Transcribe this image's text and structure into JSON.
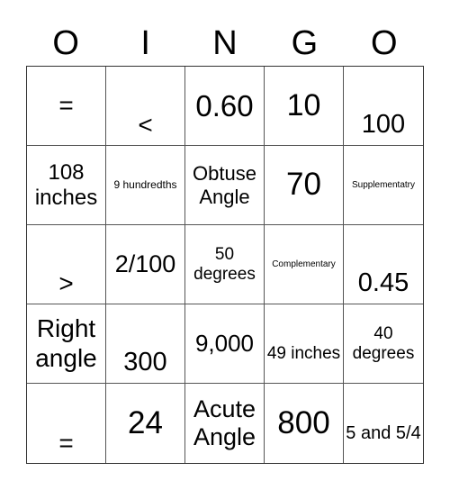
{
  "header": [
    "O",
    "I",
    "N",
    "G",
    "O"
  ],
  "cells": [
    [
      {
        "text": "=",
        "size": 28,
        "align": "middle"
      },
      {
        "text": "<",
        "size": 28,
        "align": "bottom"
      },
      {
        "text": "0.60",
        "size": 33,
        "align": "middle"
      },
      {
        "text": "10",
        "size": 34,
        "align": "middle"
      },
      {
        "text": "100",
        "size": 29,
        "align": "bottom"
      }
    ],
    [
      {
        "text": "108 inches",
        "size": 24,
        "align": "middle"
      },
      {
        "text": "9 hundredths",
        "size": 12,
        "align": "middle"
      },
      {
        "text": "Obtuse Angle",
        "size": 22,
        "align": "middle"
      },
      {
        "text": "70",
        "size": 35,
        "align": "middle"
      },
      {
        "text": "Supplementatry",
        "size": 10,
        "align": "middle"
      }
    ],
    [
      {
        "text": ">",
        "size": 28,
        "align": "bottom"
      },
      {
        "text": "2/100",
        "size": 27,
        "align": "middle"
      },
      {
        "text": "50 degrees",
        "size": 19,
        "align": "middle"
      },
      {
        "text": "Complementary",
        "size": 10,
        "align": "middle"
      },
      {
        "text": "0.45",
        "size": 29,
        "align": "bottom"
      }
    ],
    [
      {
        "text": "Right angle",
        "size": 28,
        "align": "middle"
      },
      {
        "text": "300",
        "size": 29,
        "align": "bottom"
      },
      {
        "text": "9,000",
        "size": 26,
        "align": "middle"
      },
      {
        "text": "49 inches",
        "size": 19,
        "align": "low"
      },
      {
        "text": "40 degrees",
        "size": 19,
        "align": "middle"
      }
    ],
    [
      {
        "text": "=",
        "size": 28,
        "align": "bottom"
      },
      {
        "text": "24",
        "size": 35,
        "align": "middle"
      },
      {
        "text": "Acute Angle",
        "size": 27,
        "align": "middle"
      },
      {
        "text": "800",
        "size": 35,
        "align": "middle"
      },
      {
        "text": "5 and 5/4",
        "size": 20,
        "align": "low"
      }
    ]
  ]
}
